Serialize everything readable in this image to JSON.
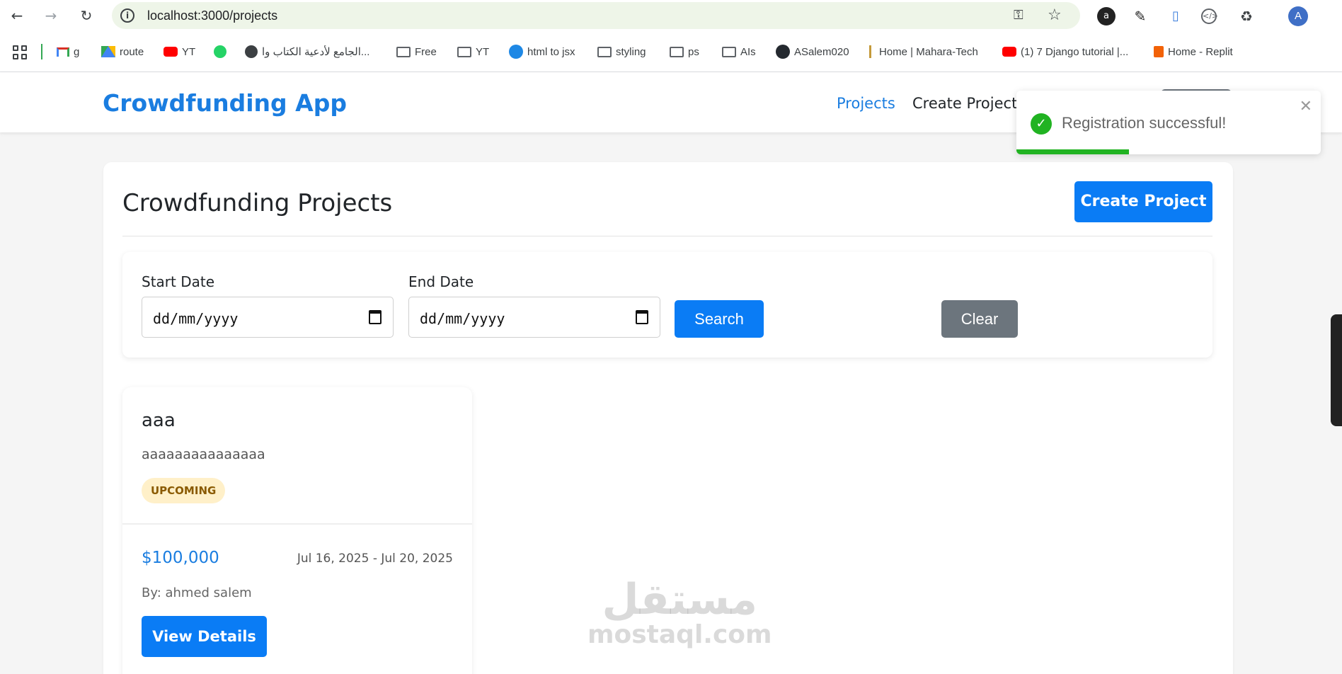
{
  "browser": {
    "url": "localhost:3000/projects",
    "profile_initial": "A",
    "bookmarks": [
      {
        "label": "g",
        "icon": "gmail-icon"
      },
      {
        "label": "route",
        "icon": "drive-icon"
      },
      {
        "label": "YT",
        "icon": "youtube-icon"
      },
      {
        "label": "",
        "icon": "whatsapp-icon"
      },
      {
        "label": "الجامع لأدعية الكتاب وا...",
        "icon": "globe-icon"
      },
      {
        "label": "Free",
        "icon": "folder-icon"
      },
      {
        "label": "YT",
        "icon": "folder-icon"
      },
      {
        "label": "html to jsx",
        "icon": "transform-icon"
      },
      {
        "label": "styling",
        "icon": "folder-icon"
      },
      {
        "label": "ps",
        "icon": "folder-icon"
      },
      {
        "label": "AIs",
        "icon": "folder-icon"
      },
      {
        "label": "ASalem020",
        "icon": "github-icon"
      },
      {
        "label": "Home | Mahara-Tech",
        "icon": "mahara-icon"
      },
      {
        "label": "(1) 7 Django tutorial |...",
        "icon": "youtube-icon"
      },
      {
        "label": "Home - Replit",
        "icon": "replit-icon"
      }
    ]
  },
  "header": {
    "brand": "Crowdfunding App",
    "nav": {
      "projects": "Projects",
      "create": "Create Project"
    }
  },
  "toast": {
    "message": "Registration successful!",
    "progress": 0.37
  },
  "main": {
    "title": "Crowdfunding Projects",
    "create_button": "Create Project",
    "filter": {
      "start_label": "Start Date",
      "start_value": "dd/mm/yyyy",
      "end_label": "End Date",
      "end_value": "dd/mm/yyyy",
      "search_button": "Search",
      "clear_button": "Clear"
    },
    "projects": [
      {
        "title": "aaa",
        "description": "aaaaaaaaaaaaaaa",
        "status": "UPCOMING",
        "target": "$100,000",
        "dates": "Jul 16, 2025 - Jul 20, 2025",
        "owner": "By: ahmed salem",
        "view_button": "View Details"
      }
    ]
  },
  "watermark": {
    "arabic": "مستقل",
    "latin": "mostaql.com"
  },
  "colors": {
    "primary": "#0a7cf5",
    "success": "#21b322",
    "secondary": "#6c757d",
    "badge_bg": "#fff0c9"
  }
}
